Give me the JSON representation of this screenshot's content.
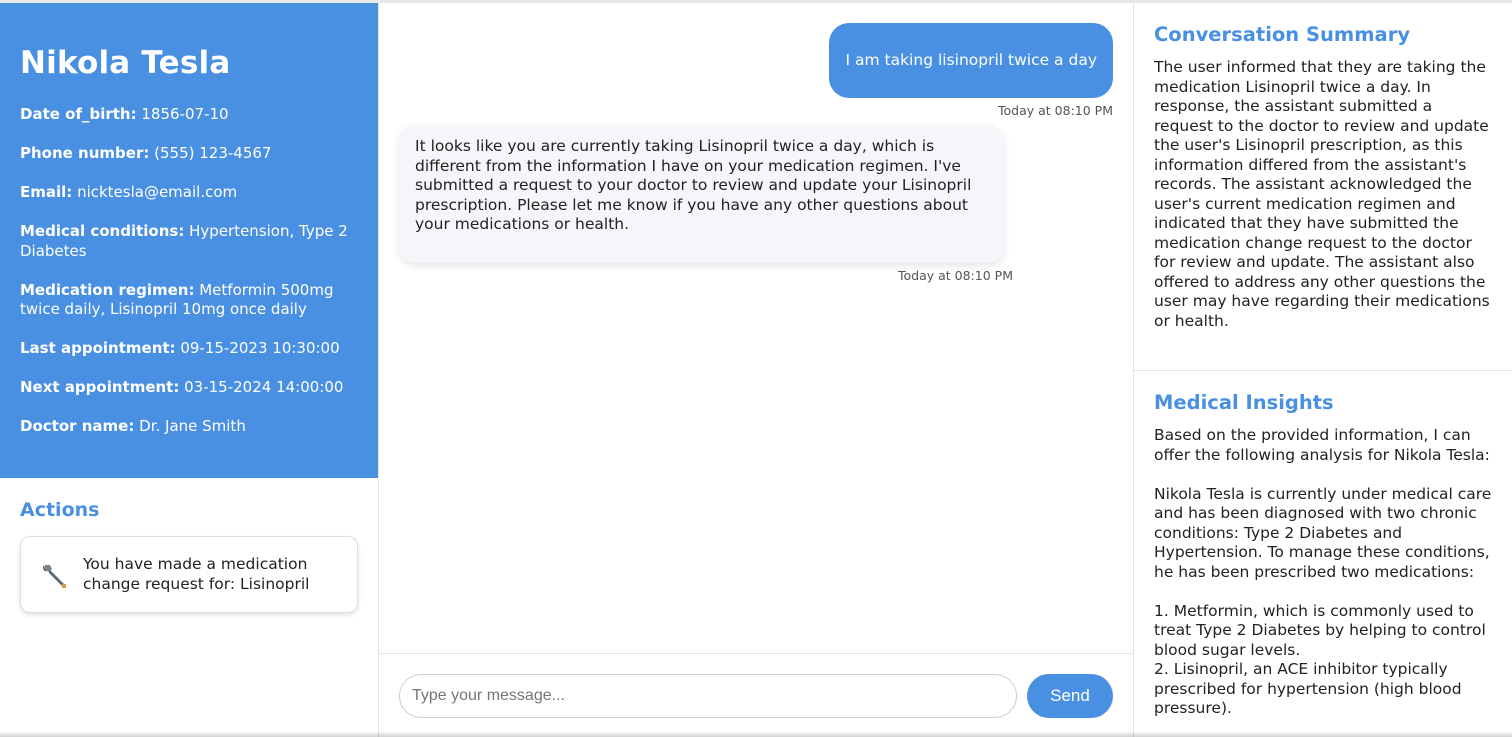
{
  "profile": {
    "name": "Nikola Tesla",
    "fields": [
      {
        "label": "Date of_birth:",
        "value": "1856-07-10"
      },
      {
        "label": "Phone number:",
        "value": "(555) 123-4567"
      },
      {
        "label": "Email:",
        "value": "nicktesla@email.com"
      },
      {
        "label": "Medical conditions:",
        "value": "Hypertension, Type 2 Diabetes"
      },
      {
        "label": "Medication regimen:",
        "value": "Metformin 500mg twice daily, Lisinopril 10mg once daily"
      },
      {
        "label": "Last appointment:",
        "value": "09-15-2023 10:30:00"
      },
      {
        "label": "Next appointment:",
        "value": "03-15-2024 14:00:00"
      },
      {
        "label": "Doctor name:",
        "value": "Dr. Jane Smith"
      }
    ]
  },
  "actions": {
    "title": "Actions",
    "items": [
      {
        "icon": "wrench-icon",
        "text": "You have made a medication change request for: Lisinopril"
      }
    ]
  },
  "chat": {
    "messages": [
      {
        "role": "user",
        "text": "I am taking lisinopril twice a day",
        "time": "Today at 08:10 PM"
      },
      {
        "role": "assistant",
        "text": "It looks like you are currently taking Lisinopril twice a day, which is different from the information I have on your medication regimen. I've submitted a request to your doctor to review and update your Lisinopril prescription. Please let me know if you have any other questions about your medications or health.",
        "time": "Today at 08:10 PM"
      }
    ],
    "input_placeholder": "Type your message...",
    "send_label": "Send"
  },
  "summary": {
    "title": "Conversation Summary",
    "text": "The user informed that they are taking the medication Lisinopril twice a day. In response, the assistant submitted a request to the doctor to review and update the user's Lisinopril prescription, as this information differed from the assistant's records. The assistant acknowledged the user's current medication regimen and indicated that they have submitted the medication change request to the doctor for review and update. The assistant also offered to address any other questions the user may have regarding their medications or health."
  },
  "insights": {
    "title": "Medical Insights",
    "text": "Based on the provided information, I can offer the following analysis for Nikola Tesla:\n\nNikola Tesla is currently under medical care and has been diagnosed with two chronic conditions: Type 2 Diabetes and Hypertension. To manage these conditions, he has been prescribed two medications:\n\n1. Metformin, which is commonly used to treat Type 2 Diabetes by helping to control blood sugar levels.\n2. Lisinopril, an ACE inhibitor typically prescribed for hypertension (high blood pressure)."
  },
  "colors": {
    "accent": "#4a90e2",
    "bot_bubble": "#f4f6f9"
  }
}
